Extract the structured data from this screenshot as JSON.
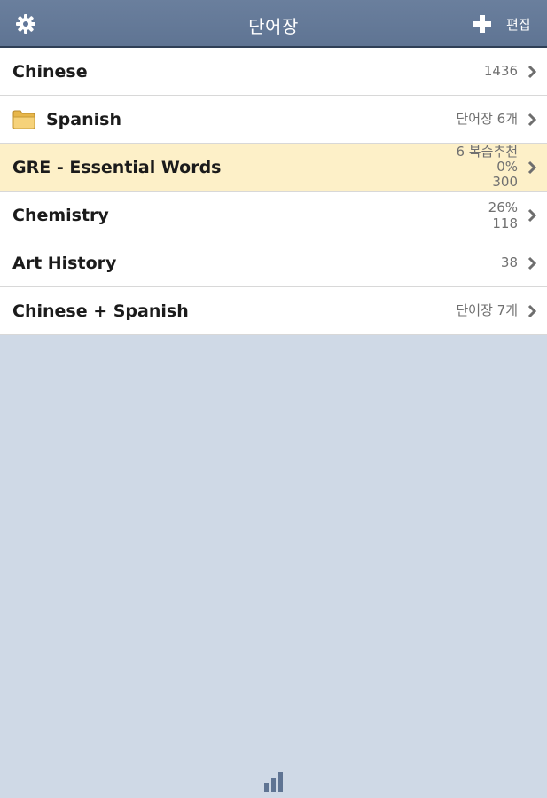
{
  "header": {
    "title": "단어장",
    "edit_label": "편집",
    "settings_icon": "gear-icon",
    "add_icon": "plus-icon"
  },
  "rows": [
    {
      "title": "Chinese",
      "meta": [
        "1436"
      ],
      "highlight": false,
      "folder": false
    },
    {
      "title": "Spanish",
      "meta": [
        "단어장 6개"
      ],
      "highlight": false,
      "folder": true
    },
    {
      "title": "GRE - Essential Words",
      "meta": [
        "6 복습추천",
        "0%",
        "300"
      ],
      "highlight": true,
      "folder": false
    },
    {
      "title": "Chemistry",
      "meta": [
        "26%",
        "118"
      ],
      "highlight": false,
      "folder": false
    },
    {
      "title": "Art History",
      "meta": [
        "38"
      ],
      "highlight": false,
      "folder": false
    },
    {
      "title": "Chinese + Spanish",
      "meta": [
        "단어장 7개"
      ],
      "highlight": false,
      "folder": false
    }
  ],
  "colors": {
    "header_bg": "#61779a",
    "highlight_row": "#fdf0c8",
    "page_bg": "#cfd9e6",
    "meta_text": "#707070"
  },
  "footer": {
    "stats_icon": "bar-chart-icon"
  }
}
